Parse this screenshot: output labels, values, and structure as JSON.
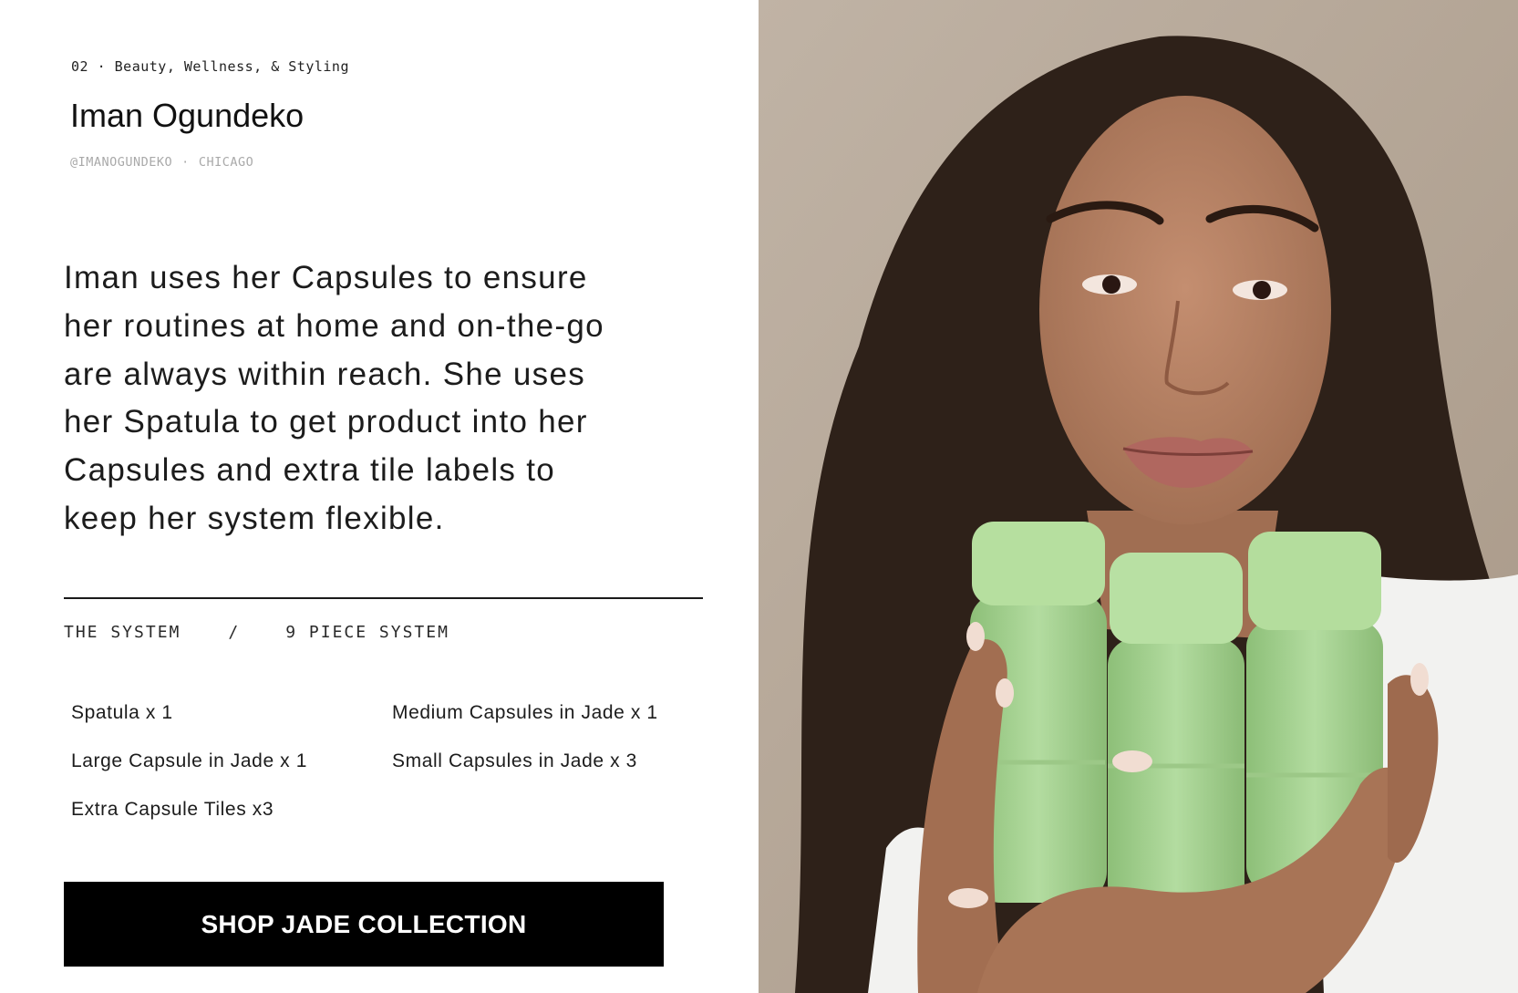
{
  "profile": {
    "eyebrow": "02 · Beauty, Wellness, & Styling",
    "name": "Iman Ogundeko",
    "handle": "@IMANOGUNDEKO",
    "separator": "·",
    "location": "CHICAGO"
  },
  "quote": {
    "lines": [
      "Iman uses her Capsules to ensure",
      "her routines at home and on-the-go",
      "are always within reach. She uses",
      "her Spatula to get product into her",
      "Capsules and extra tile labels to",
      "keep her system flexible."
    ]
  },
  "system": {
    "label": "THE SYSTEM",
    "divider": "/",
    "name": "9 PIECE SYSTEM",
    "items": [
      "Spatula  x 1",
      "Medium Capsules in Jade x 1",
      "Large Capsule in Jade x 1",
      "Small Capsules in Jade x 3",
      "Extra Capsule Tiles x3"
    ]
  },
  "cta": {
    "label": "SHOP JADE COLLECTION"
  },
  "photo": {
    "subject": "woman-holding-jade-capsules",
    "colors": {
      "wall": "#b7a99a",
      "hair": "#2e2119",
      "skin": "#b98466",
      "jade": "#a5d191",
      "shirt": "#f2f2f0"
    }
  }
}
